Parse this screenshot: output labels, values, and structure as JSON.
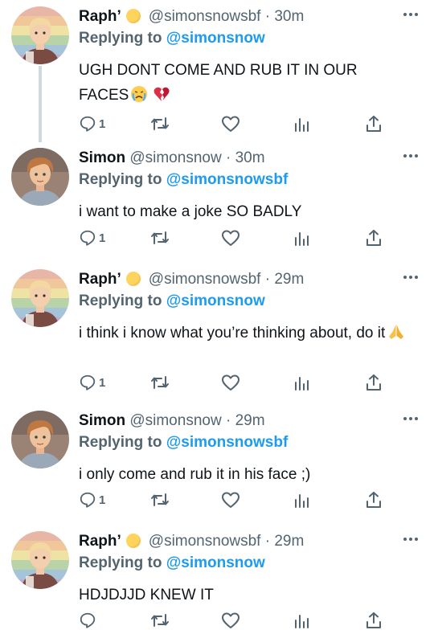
{
  "colors": {
    "link": "#1d9bf0",
    "muted": "#536471",
    "text": "#0f1419",
    "thread_line": "#cfd9de"
  },
  "tweets": [
    {
      "author": "raph",
      "name": "Raph’",
      "badge_icon": "sun-emoji-icon",
      "handle": "@simonsnowsbf",
      "dot": "·",
      "time": "30m",
      "reply_label": "Replying to",
      "reply_to": "@simonsnow",
      "text": "UGH DONT COME AND RUB IT IN OUR FACES",
      "trailing_emoji": [
        "crying-face-icon",
        "broken-heart-icon"
      ],
      "reply_count": "1"
    },
    {
      "author": "simon",
      "name": "Simon",
      "handle": "@simonsnow",
      "dot": "·",
      "time": "30m",
      "reply_label": "Replying to",
      "reply_to": "@simonsnowsbf",
      "text": "i want to make a joke SO BADLY",
      "reply_count": "1"
    },
    {
      "author": "raph",
      "name": "Raph’",
      "badge_icon": "sun-emoji-icon",
      "handle": "@simonsnowsbf",
      "dot": "·",
      "time": "29m",
      "reply_label": "Replying to",
      "reply_to": "@simonsnow",
      "text": "i think i know what you’re thinking about, do it",
      "trailing_emoji": [
        "folded-hands-icon"
      ],
      "reply_count": "1"
    },
    {
      "author": "simon",
      "name": "Simon",
      "handle": "@simonsnow",
      "dot": "·",
      "time": "29m",
      "reply_label": "Replying to",
      "reply_to": "@simonsnowsbf",
      "text": "i only come and rub it in his face ;)",
      "reply_count": "1"
    },
    {
      "author": "raph",
      "name": "Raph’",
      "badge_icon": "sun-emoji-icon",
      "handle": "@simonsnowsbf",
      "dot": "·",
      "time": "29m",
      "reply_label": "Replying to",
      "reply_to": "@simonsnow",
      "text": "HDJDJJD KNEW IT",
      "reply_count": ""
    }
  ],
  "action_icons": [
    "reply-icon",
    "retweet-icon",
    "like-icon",
    "analytics-icon",
    "share-icon"
  ]
}
